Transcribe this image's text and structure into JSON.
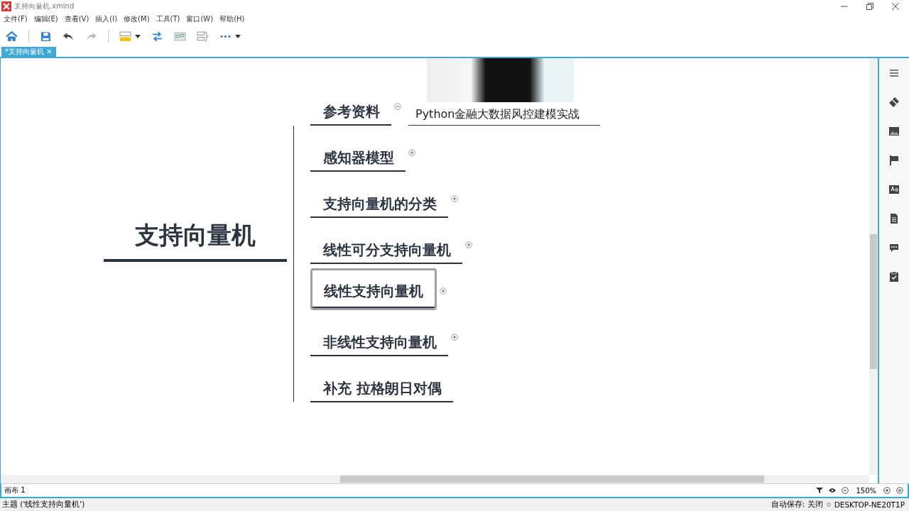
{
  "window": {
    "title": "支持向量机.xmind"
  },
  "menu": [
    "文件(F)",
    "编辑(E)",
    "查看(V)",
    "插入(I)",
    "修改(M)",
    "工具(T)",
    "窗口(W)",
    "帮助(H)"
  ],
  "document_tab": {
    "label": "*支持向量机",
    "close": "✕"
  },
  "mindmap": {
    "central": "支持向量机",
    "branches": [
      {
        "label": "参考资料",
        "selected": false,
        "collapsed": false,
        "attachment": {
          "caption": "Python金融大数据风控建模实战"
        }
      },
      {
        "label": "感知器模型",
        "selected": false,
        "collapsed": true
      },
      {
        "label": "支持向量机的分类",
        "selected": false,
        "collapsed": true
      },
      {
        "label": "线性可分支持向量机",
        "selected": false,
        "collapsed": true
      },
      {
        "label": "线性支持向量机",
        "selected": true,
        "collapsed": true
      },
      {
        "label": "非线性支持向量机",
        "selected": false,
        "collapsed": true
      },
      {
        "label": "补充 拉格朗日对偶",
        "selected": false
      }
    ]
  },
  "sheet_bar": {
    "sheet": "画布 1",
    "zoom": "150%"
  },
  "status_bar": {
    "topic": "主题 ('线性支持向量机')",
    "autosave": "自动保存: 关闭",
    "machine": "DESKTOP-NE20T1P"
  }
}
